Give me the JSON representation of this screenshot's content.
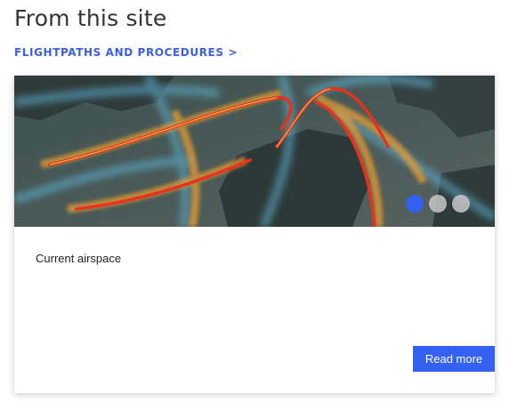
{
  "section": {
    "title": "From this site",
    "link_label": "FLIGHTPATHS AND PROCEDURES >"
  },
  "card": {
    "image_alt": "Flight path density map",
    "text": "Current airspace",
    "read_more_label": "Read more",
    "carousel": {
      "slide_count": 3,
      "active_index": 0
    }
  },
  "colors": {
    "accent": "#3561f0",
    "link": "#3a5fe0",
    "title": "#333333",
    "dot_inactive": "#c8c8c8"
  }
}
